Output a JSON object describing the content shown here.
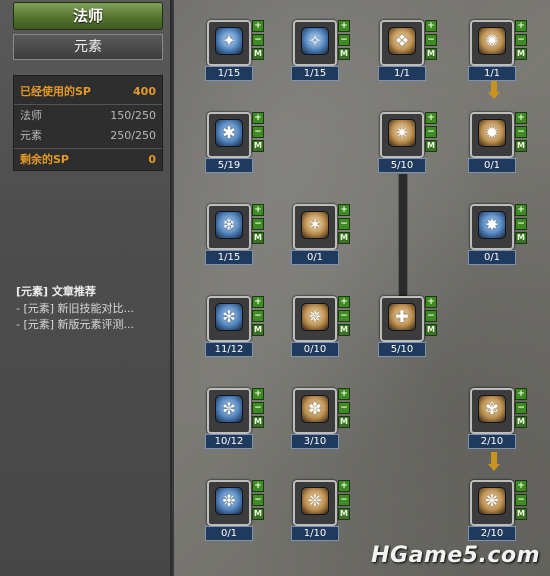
{
  "left_panel": {
    "class_tab": "法师",
    "subclass_tab": "元素",
    "sp": {
      "used_label": "已经使用的SP",
      "used_value": "400",
      "rows": [
        {
          "label": "法师",
          "value": "150/250"
        },
        {
          "label": "元素",
          "value": "250/250"
        }
      ],
      "remaining_label": "剩余的SP",
      "remaining_value": "0"
    },
    "articles": {
      "title": "[元素] 文章推荐",
      "links": [
        "- [元素] 新旧技能对比...",
        "- [元素] 新版元素评测..."
      ]
    }
  },
  "skill_controls": {
    "plus": "+",
    "minus": "−",
    "max": "M"
  },
  "skills": [
    {
      "id": "r1c1",
      "level": "1/15",
      "glyph": "✦",
      "tone": "cool"
    },
    {
      "id": "r1c2",
      "level": "1/15",
      "glyph": "✧",
      "tone": "cool"
    },
    {
      "id": "r1c3",
      "level": "1/1",
      "glyph": "❖",
      "tone": "warm"
    },
    {
      "id": "r1c4",
      "level": "1/1",
      "glyph": "✺",
      "tone": "warm"
    },
    {
      "id": "r2c1",
      "level": "5/19",
      "glyph": "✱",
      "tone": "cool"
    },
    {
      "id": "r2c3",
      "level": "5/10",
      "glyph": "✷",
      "tone": "warm"
    },
    {
      "id": "r2c4",
      "level": "0/1",
      "glyph": "✹",
      "tone": "warm"
    },
    {
      "id": "r3c1",
      "level": "1/15",
      "glyph": "❄",
      "tone": "cool"
    },
    {
      "id": "r3c2",
      "level": "0/1",
      "glyph": "✶",
      "tone": "warm"
    },
    {
      "id": "r3c4",
      "level": "0/1",
      "glyph": "✸",
      "tone": "cool"
    },
    {
      "id": "r4c1",
      "level": "11/12",
      "glyph": "✻",
      "tone": "cool"
    },
    {
      "id": "r4c2",
      "level": "0/10",
      "glyph": "✵",
      "tone": "warm"
    },
    {
      "id": "r4c3",
      "level": "5/10",
      "glyph": "✚",
      "tone": "warm"
    },
    {
      "id": "r5c1",
      "level": "10/12",
      "glyph": "✼",
      "tone": "cool"
    },
    {
      "id": "r5c2",
      "level": "3/10",
      "glyph": "✽",
      "tone": "warm"
    },
    {
      "id": "r5c4",
      "level": "2/10",
      "glyph": "✾",
      "tone": "warm"
    },
    {
      "id": "r6c1",
      "level": "0/1",
      "glyph": "❉",
      "tone": "cool"
    },
    {
      "id": "r6c2",
      "level": "1/10",
      "glyph": "❊",
      "tone": "warm"
    },
    {
      "id": "r6c4",
      "level": "2/10",
      "glyph": "❋",
      "tone": "warm"
    }
  ],
  "watermark": "HGame5.com"
}
